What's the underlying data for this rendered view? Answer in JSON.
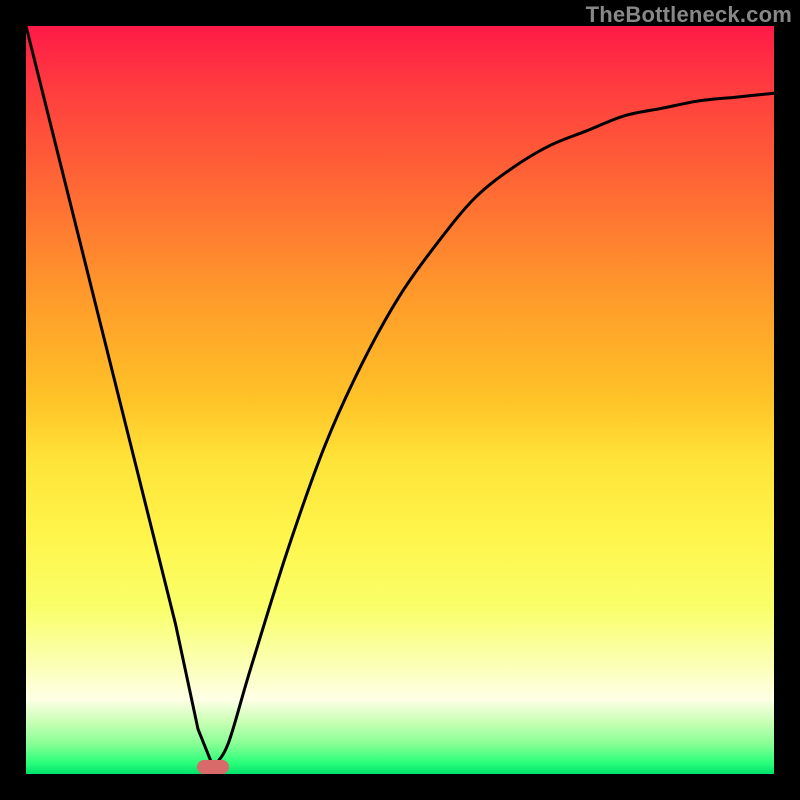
{
  "watermark": "TheBottleneck.com",
  "colors": {
    "frame": "#000000",
    "curve": "#000000",
    "min_marker": "#d86a6a"
  },
  "chart_data": {
    "type": "line",
    "title": "",
    "xlabel": "",
    "ylabel": "",
    "xlim": [
      0,
      100
    ],
    "ylim": [
      0,
      100
    ],
    "grid": false,
    "legend": false,
    "description": "V-shaped bottleneck curve drawn over a vertical red-to-green gradient. The minimum of the curve (marked with a small rounded rectangle) near x≈25 is the minimum-bottleneck region.",
    "series": [
      {
        "name": "bottleneck-curve",
        "x": [
          0,
          5,
          10,
          15,
          20,
          23,
          25,
          27,
          30,
          35,
          40,
          45,
          50,
          55,
          60,
          65,
          70,
          75,
          80,
          85,
          90,
          95,
          100
        ],
        "y": [
          100,
          80,
          60,
          40,
          20,
          6,
          1,
          4,
          14,
          30,
          44,
          55,
          64,
          71,
          77,
          81,
          84,
          86,
          88,
          89,
          90,
          90.5,
          91
        ]
      }
    ],
    "min_marker": {
      "x": 25,
      "y": 1
    }
  }
}
